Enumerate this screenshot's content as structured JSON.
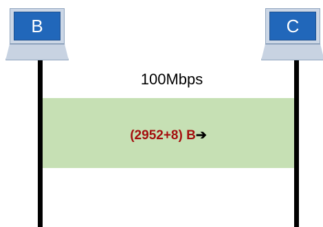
{
  "nodes": {
    "b": {
      "label": "B"
    },
    "c": {
      "label": "C"
    }
  },
  "link": {
    "rate": "100Mbps"
  },
  "packet": {
    "size_text": "(2952+8) B",
    "direction_glyph": "➔"
  },
  "colors": {
    "screen": "#2167ba",
    "channel": "#c6e0b4",
    "packet_text": "#a50f0f",
    "timeline": "#000000"
  }
}
